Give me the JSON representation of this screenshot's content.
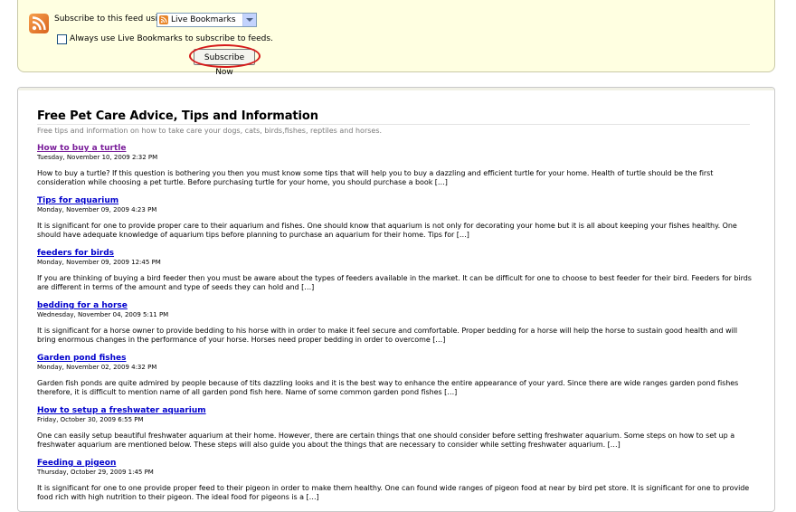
{
  "subscribe": {
    "label": "Subscribe to this feed using",
    "reader": "Live Bookmarks",
    "always_label": "Always use Live Bookmarks to subscribe to feeds.",
    "always_checked": false,
    "button_label": "Subscribe Now",
    "highlight_color": "#d51a1a"
  },
  "feed": {
    "title": "Free Pet Care Advice, Tips and Information",
    "subtitle": "Free tips and information on how to take care your dogs, cats, birds,fishes, reptiles and horses.",
    "entries": [
      {
        "title": "How to buy a turtle",
        "date": "Tuesday, November 10, 2009 2:32 PM",
        "summary": "How to buy a turtle? If this question is bothering you then you must know some tips that will help you to buy a dazzling and efficient turtle for your home. Health of turtle should be the first consideration while choosing a pet turtle. Before purchasing turtle for your home, you should purchase a book […]",
        "visited": true
      },
      {
        "title": "Tips for aquarium",
        "date": "Monday, November 09, 2009 4:23 PM",
        "summary": "It is significant for one to provide proper care to their aquarium and fishes. One should know that aquarium is not only for decorating your home but it is all about keeping your fishes healthy. One should have adequate knowledge of aquarium tips before planning to purchase an aquarium for their home. Tips for […]",
        "visited": false
      },
      {
        "title": "feeders for birds",
        "date": "Monday, November 09, 2009 12:45 PM",
        "summary": "If you are thinking of buying a bird feeder then you must be aware about the types of feeders available in the market. It can be difficult for one to choose to best feeder for their bird. Feeders for birds are different in terms of the amount and type of seeds they can hold and […]",
        "visited": false
      },
      {
        "title": "bedding for a horse",
        "date": "Wednesday, November 04, 2009 5:11 PM",
        "summary": "It is significant for a horse owner to provide bedding to his horse with in order to make it feel secure and comfortable. Proper bedding for a horse will help the horse to sustain good health and will bring enormous changes in the performance of your horse. Horses need proper bedding in order to overcome […]",
        "visited": false
      },
      {
        "title": "Garden pond fishes",
        "date": "Monday, November 02, 2009 4:32 PM",
        "summary": "Garden fish ponds are quite admired by people because of tits dazzling looks and it is the best way to enhance the entire appearance of your yard. Since there are wide ranges garden pond fishes therefore, it is difficult to mention name of all garden pond fish here. Name of some common garden pond fishes […]",
        "visited": false
      },
      {
        "title": "How to setup a freshwater aquarium",
        "date": "Friday, October 30, 2009 6:55 PM",
        "summary": "One can easily setup beautiful freshwater aquarium at their home. However, there are certain things that one should consider before setting freshwater aquarium. Some steps on how to set up a freshwater aquarium are mentioned below. These steps will also guide you about the things that are necessary to consider while setting freshwater aquarium. […]",
        "visited": false
      },
      {
        "title": "Feeding a pigeon",
        "date": "Thursday, October 29, 2009 1:45 PM",
        "summary": "It is significant for one to one provide proper feed to their pigeon in order to make them healthy. One can found wide ranges of pigeon food at near by bird pet store. It is significant for one to provide food rich with high nutrition to their pigeon. The ideal food for pigeons is a […]",
        "visited": false
      }
    ]
  }
}
